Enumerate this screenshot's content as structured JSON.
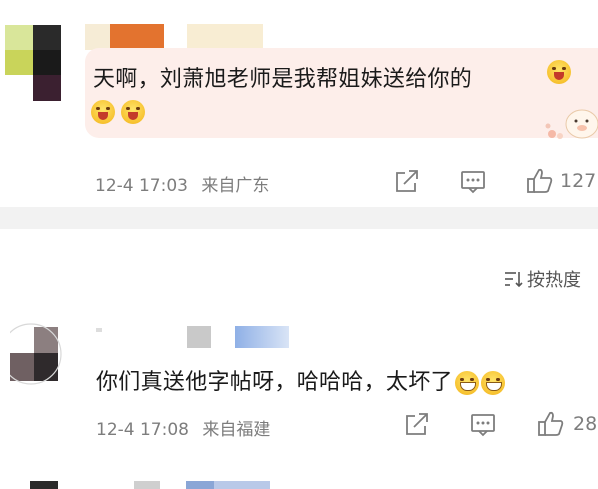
{
  "comments": [
    {
      "text": "天啊，刘萧旭老师是我帮姐妹送给你的",
      "time": "12-4 17:03",
      "location": "来自广东",
      "like_count": "127",
      "emoji": [
        "scream-emoji",
        "scream-emoji",
        "scream-emoji"
      ]
    },
    {
      "text": "你们真送他字帖呀，哈哈哈，太坏了",
      "time": "12-4 17:08",
      "location": "来自福建",
      "like_count": "28",
      "emoji": [
        "grin-emoji",
        "grin-emoji"
      ]
    }
  ],
  "sort": {
    "label": "按热度"
  },
  "icons": {
    "share": "share-icon",
    "reply": "comment-icon",
    "like": "thumbs-up-icon",
    "sort": "sort-icon"
  },
  "colors": {
    "bubble": "#fdeeea",
    "divider": "#f2f2f2",
    "meta_text": "#7d7d7d"
  }
}
